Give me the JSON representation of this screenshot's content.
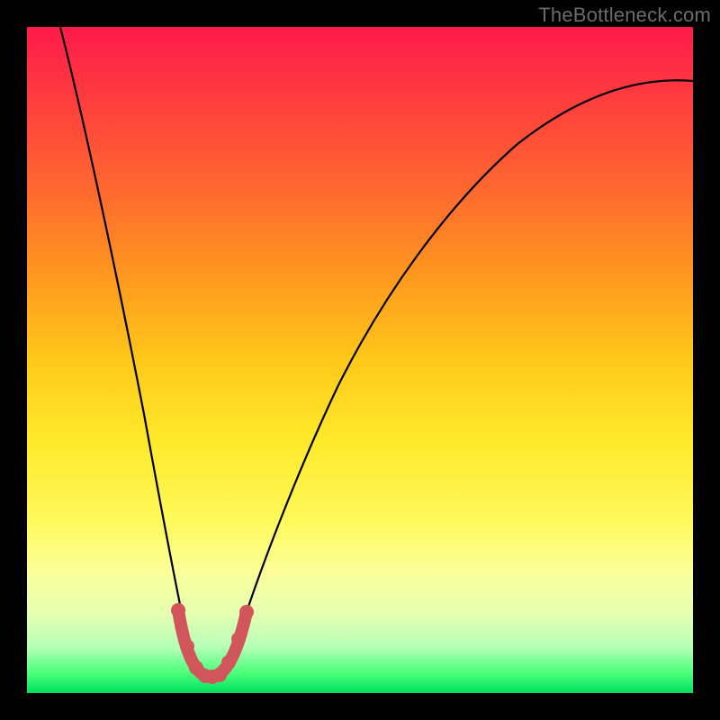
{
  "watermark": "TheBottleneck.com",
  "colors": {
    "curve": "#000000",
    "highlight": "#d1565b",
    "gradient_top": "#ff1a4b",
    "gradient_bottom": "#00e060"
  },
  "chart_data": {
    "type": "line",
    "title": "",
    "xlabel": "",
    "ylabel": "",
    "xlim": [
      0,
      100
    ],
    "ylim": [
      0,
      100
    ],
    "grid": false,
    "legend": false,
    "series": [
      {
        "name": "bottleneck-curve",
        "x": [
          5,
          10,
          15,
          18,
          20,
          22,
          24,
          26,
          27.5,
          29,
          32,
          36,
          40,
          46,
          54,
          62,
          72,
          84,
          100
        ],
        "y": [
          100,
          78,
          52,
          35,
          22,
          12,
          6,
          3,
          2.5,
          3,
          7,
          15,
          26,
          40,
          55,
          67,
          78,
          86,
          92
        ]
      }
    ],
    "highlight": {
      "name": "valley-highlight",
      "x_range": [
        22,
        32
      ],
      "points_x": [
        22.0,
        23.5,
        25.0,
        26.5,
        27.5,
        28.5,
        30.0,
        31.5,
        32.5
      ],
      "points_y": [
        12.0,
        8.0,
        5.0,
        3.0,
        2.5,
        3.0,
        5.0,
        8.0,
        11.0
      ]
    }
  }
}
